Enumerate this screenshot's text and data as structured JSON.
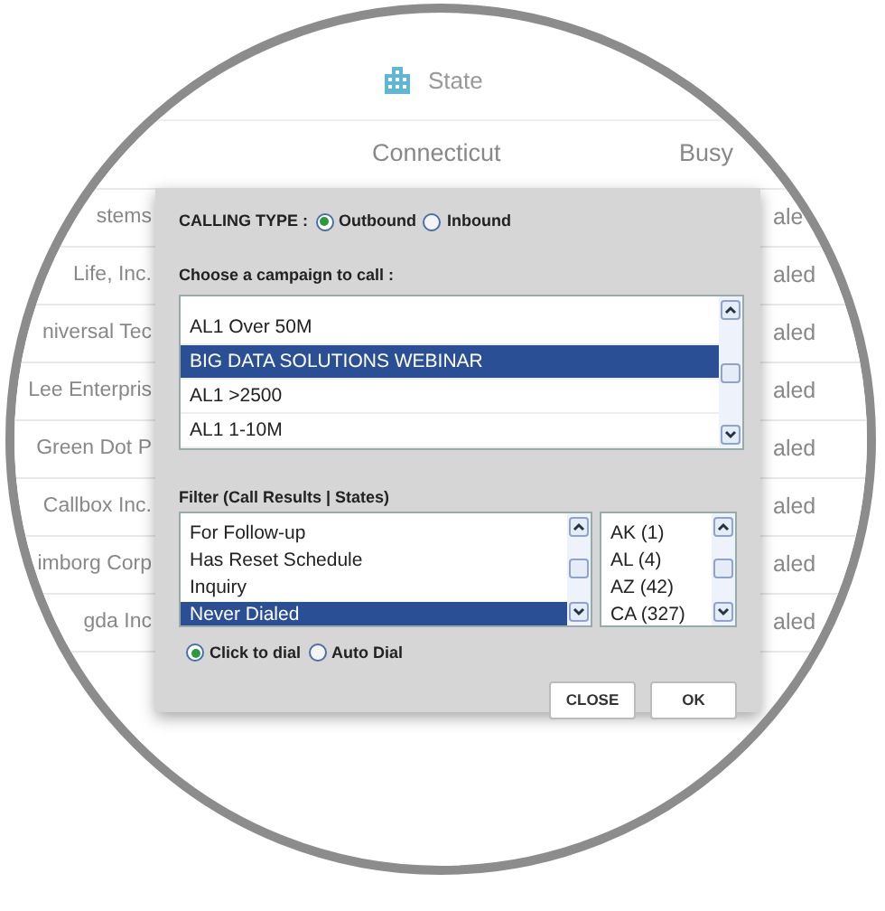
{
  "table": {
    "header": {
      "label": "State"
    },
    "rows": [
      {
        "column_1": "",
        "column_2": "Connecticut",
        "column_3": "Busy"
      },
      {
        "column_1": "stems",
        "column_3": "ale"
      },
      {
        "column_1": "Life, Inc.",
        "column_3": "aled"
      },
      {
        "column_1": "niversal Tec",
        "column_3": "aled"
      },
      {
        "column_1": "Lee Enterpris",
        "column_3": "aled"
      },
      {
        "column_1": "Green Dot P",
        "column_3": "aled"
      },
      {
        "column_1": "Callbox Inc.",
        "column_3": "aled"
      },
      {
        "column_1": "imborg Corp",
        "column_3": "aled"
      },
      {
        "column_1": "gda Inc",
        "column_3": "aled"
      }
    ]
  },
  "dialog": {
    "calling_type": {
      "label": "CALLING TYPE :",
      "options": [
        {
          "label": "Outbound",
          "selected": true
        },
        {
          "label": "Inbound",
          "selected": false
        }
      ]
    },
    "campaign": {
      "label": "Choose a campaign to call :",
      "items": [
        {
          "label": "AL1 Over 50M",
          "selected": false
        },
        {
          "label": "BIG DATA SOLUTIONS WEBINAR",
          "selected": true
        },
        {
          "label": "AL1 >2500",
          "selected": false
        },
        {
          "label": "AL1 1-10M",
          "selected": false
        }
      ]
    },
    "filter": {
      "label": "Filter (Call Results | States)",
      "call_results": [
        {
          "label": "For Follow-up",
          "selected": false
        },
        {
          "label": "Has Reset Schedule",
          "selected": false
        },
        {
          "label": "Inquiry",
          "selected": false
        },
        {
          "label": "Never Dialed",
          "selected": true
        }
      ],
      "states": [
        {
          "label": "AK (1)",
          "selected": false
        },
        {
          "label": "AL (4)",
          "selected": false
        },
        {
          "label": "AZ (42)",
          "selected": false
        },
        {
          "label": "CA (327)",
          "selected": false
        }
      ]
    },
    "dial_mode": [
      {
        "label": "Click to dial",
        "selected": true
      },
      {
        "label": "Auto Dial",
        "selected": false
      }
    ],
    "buttons": [
      "CLOSE",
      "OK"
    ]
  }
}
